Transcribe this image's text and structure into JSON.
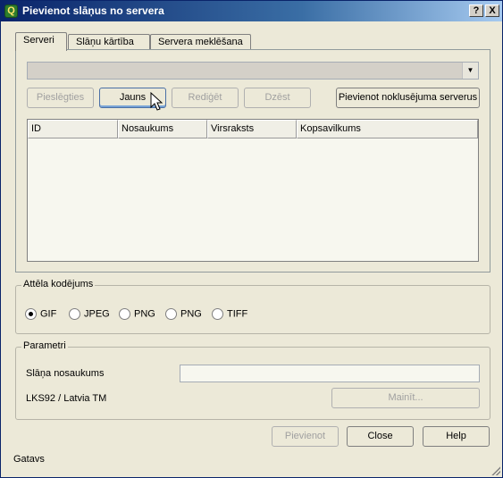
{
  "window": {
    "title": "Pievienot slāņus no servera",
    "help_button": "?",
    "close_button": "X"
  },
  "tabs": [
    {
      "label": "Serveri"
    },
    {
      "label": "Slāņu kārtība"
    },
    {
      "label": "Servera meklēšana"
    }
  ],
  "servers": {
    "selected_server": "",
    "buttons": {
      "connect": "Pieslēgties",
      "new": "Jauns",
      "edit": "Rediģēt",
      "delete": "Dzēst",
      "add_default": "Pievienot noklusējuma serverus"
    },
    "table": {
      "columns": [
        "ID",
        "Nosaukums",
        "Virsraksts",
        "Kopsavilkums"
      ],
      "rows": []
    }
  },
  "encoding": {
    "title": "Attēla kodējums",
    "options": [
      {
        "label": "GIF",
        "checked": true
      },
      {
        "label": "JPEG",
        "checked": false
      },
      {
        "label": "PNG",
        "checked": false
      },
      {
        "label": "PNG",
        "checked": false
      },
      {
        "label": "TIFF",
        "checked": false
      }
    ]
  },
  "parameters": {
    "title": "Parametri",
    "layer_name_label": "Slāņa nosaukums",
    "layer_name_value": "",
    "crs_label": "LKS92 / Latvia TM",
    "change_button": "Mainīt..."
  },
  "footer": {
    "add_button": "Pievienot",
    "close_button": "Close",
    "help_button": "Help"
  },
  "status": "Gatavs"
}
